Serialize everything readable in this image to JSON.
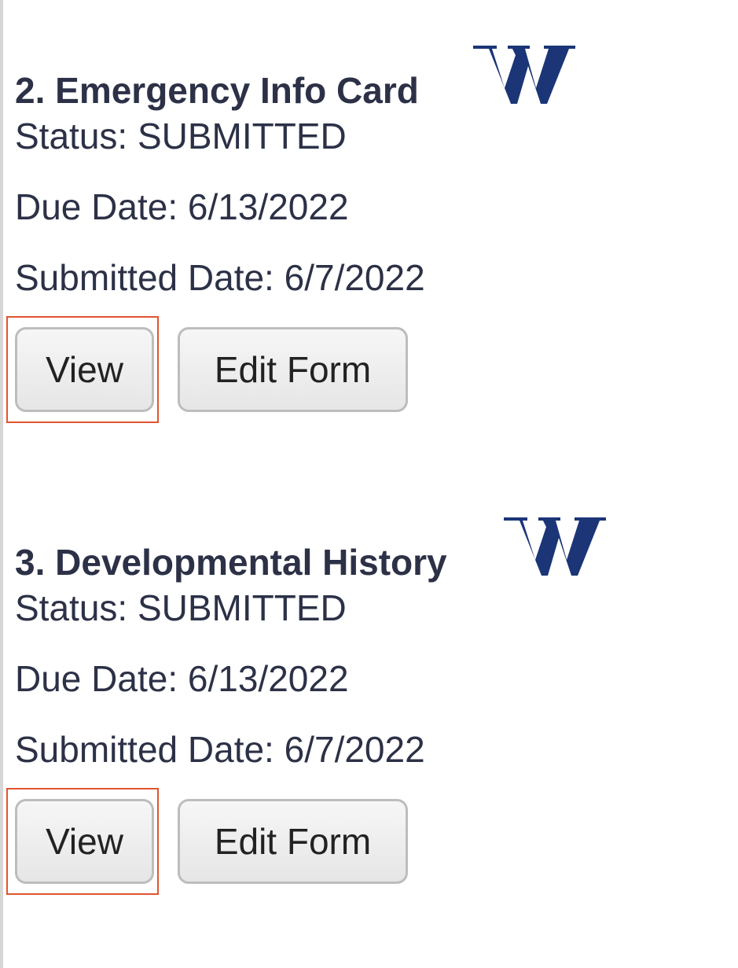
{
  "forms": [
    {
      "title": "2. Emergency Info Card",
      "status_label": "Status: ",
      "status_value": "SUBMITTED",
      "due_label": "Due Date: ",
      "due_value": "6/13/2022",
      "submitted_label": "Submitted Date: ",
      "submitted_value": "6/7/2022",
      "view_label": "View",
      "edit_label": "Edit Form"
    },
    {
      "title": "3. Developmental History",
      "status_label": "Status: ",
      "status_value": "SUBMITTED",
      "due_label": "Due Date: ",
      "due_value": "6/13/2022",
      "submitted_label": "Submitted Date: ",
      "submitted_value": "6/7/2022",
      "view_label": "View",
      "edit_label": "Edit Form"
    }
  ],
  "colors": {
    "text": "#2c3147",
    "logo": "#1b3577",
    "highlight": "#e1542f",
    "button_border": "#bdbdbd"
  },
  "icons": {
    "logo": "w-logo-icon"
  }
}
